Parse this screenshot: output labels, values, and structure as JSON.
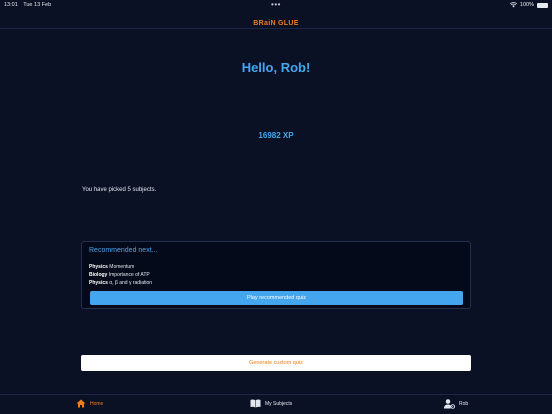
{
  "status": {
    "time": "13:01",
    "date": "Tue 13 Feb",
    "battery": "100%"
  },
  "header": {
    "logo_text": "BRaiN GLUE"
  },
  "main": {
    "greeting": "Hello, Rob!",
    "xp": "16982 XP",
    "picked_text": "You have picked 5 subjects."
  },
  "recommended": {
    "title": "Recommended next...",
    "items": [
      {
        "subject": "Physics",
        "topic": "Momentum"
      },
      {
        "subject": "Biology",
        "topic": "Importance of ATP"
      },
      {
        "subject": "Physics",
        "topic": "α, β and γ radiation"
      }
    ],
    "button_label": "Play recommended quiz"
  },
  "custom_quiz_label": "Generate custom quiz",
  "tabs": [
    {
      "label": "Home",
      "icon": "home-icon",
      "active": true
    },
    {
      "label": "My Subjects",
      "icon": "book-icon",
      "active": false
    },
    {
      "label": "Rob",
      "icon": "user-gear-icon",
      "active": false
    }
  ],
  "colors": {
    "background": "#0a1125",
    "accent_blue": "#45a6f0",
    "accent_orange": "#ee7d1a"
  }
}
